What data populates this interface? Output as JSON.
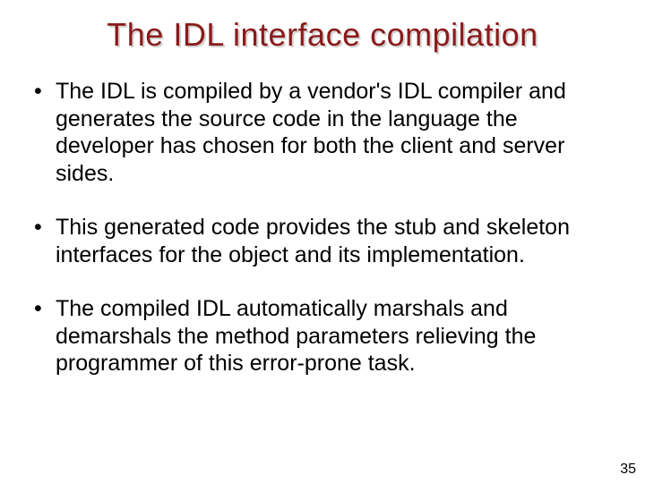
{
  "slide": {
    "title": "The IDL interface compilation",
    "bullets": [
      "The IDL is compiled by a vendor's IDL compiler and generates the source code in the language the developer has chosen for both the client and server sides.",
      "This generated code provides the stub and skeleton interfaces for the object and its implementation.",
      "The compiled IDL automatically marshals and demarshals the method parameters relieving the programmer of this error-prone task."
    ],
    "page_number": "35"
  }
}
